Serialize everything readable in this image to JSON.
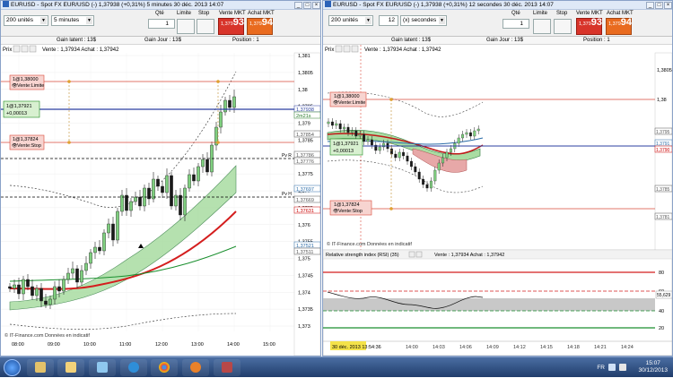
{
  "left_window": {
    "title": "EURUSD - Spot FX EUR/USD (-)   1,37938 (+0,31%)   5 minutes   30 déc. 2013 14:07",
    "units_select": "200 unités",
    "period_select": "5 minutes",
    "qty_label": "Qté",
    "qty_value": "1",
    "limit_label": "Limite",
    "stop_label": "Stop",
    "sell_label": "Vente MKT",
    "sell_price_prefix": "1,379",
    "sell_price_big": "93",
    "buy_label": "Achat MKT",
    "buy_price_prefix": "1,379",
    "buy_price_big": "94",
    "gain_latent": "Gain latent : 13$",
    "gain_jour": "Gain Jour : 13$",
    "position": "Position : 1",
    "header_prix": "Prix",
    "header_quote": "Vente : 1,37934  Achat : 1,37942",
    "order_limit_price": "1@1,38000",
    "order_limit_label": "Vente:Limite",
    "position_price": "1@1,37921",
    "position_gain": "+0,00013",
    "order_stop_price": "1@1,37824",
    "order_stop_label": "Vente:Stop",
    "pivot_r": "Pv R",
    "pivot_h": "Pv H",
    "watermark": "© IT-Finance.com  Données en indicatif",
    "y_ticks": [
      "1,381",
      "1,3805",
      "1,38",
      "1,3795",
      "1,379",
      "1,3785",
      "1,378",
      "1,3775",
      "1,377",
      "1,3765",
      "1,376",
      "1,3755",
      "1,375",
      "1,3745",
      "1,374",
      "1,3735",
      "1,373"
    ],
    "x_ticks": [
      "08:00",
      "09:00",
      "10:00",
      "11:00",
      "12:00",
      "13:00",
      "14:00",
      "15:00"
    ],
    "price_labels": [
      {
        "text": "1,37938",
        "color": "#2b3fa0"
      },
      {
        "text": "2m21s",
        "color": "#2b7d2b"
      },
      {
        "text": "1,37854",
        "color": "#555555"
      },
      {
        "text": "1,37786",
        "color": "#555555"
      },
      {
        "text": "1,37776",
        "color": "#555555"
      },
      {
        "text": "1,37697",
        "color": "#2b6ca8"
      },
      {
        "text": "1,37669",
        "color": "#555555"
      },
      {
        "text": "1,37631",
        "color": "#cc0000"
      },
      {
        "text": "1,37521",
        "color": "#2b6ca8"
      },
      {
        "text": "1,37511",
        "color": "#555555"
      }
    ]
  },
  "right_window": {
    "title": "EURUSD - Spot FX EUR/USD (-)   1,37938 (+0,31%)   12 secondes   30 déc. 2013 14:07",
    "units_select": "200 unités",
    "period_value": "12",
    "period_select": "(x) secondes",
    "qty_label": "Qté",
    "qty_value": "1",
    "limit_label": "Limite",
    "stop_label": "Stop",
    "sell_label": "Vente MKT",
    "sell_price_prefix": "1,379",
    "sell_price_big": "93",
    "buy_label": "Achat MKT",
    "buy_price_prefix": "1,379",
    "buy_price_big": "94",
    "gain_latent": "Gain latent : 13$",
    "gain_jour": "Gain Jour : 13$",
    "position": "Position : 1",
    "header_prix": "Prix",
    "header_quote": "Vente : 1,37934  Achat : 1,37942",
    "order_limit_price": "1@1,38000",
    "order_limit_label": "Vente:Limite",
    "position_price": "1@1,37921",
    "position_gain": "+0,00013",
    "order_stop_price": "1@1,37824",
    "order_stop_label": "Vente:Stop",
    "watermark": "© IT-Finance.com  Données en indicatif",
    "rsi_title": "Relative strength index (RSI) (35)",
    "rsi_quote": "Vente : 1,37934  Achat : 1,37942",
    "rsi_value": "55,629",
    "rsi_ticks": [
      "80",
      "60",
      "40",
      "20"
    ],
    "y_ticks": [
      "1,3805",
      "1,38",
      "1,3795",
      "1,379",
      "1,3785",
      "1,378"
    ],
    "x_ticks": [
      "30 déc. 2013 13:54:36",
      "14:00",
      "14:03",
      "14:06",
      "14:09",
      "14:12",
      "14:15",
      "14:18",
      "14:21",
      "14:24"
    ],
    "price_labels": [
      {
        "text": "1,3795",
        "color": "#555555"
      },
      {
        "text": "1,3791",
        "color": "#2b6ca8"
      },
      {
        "text": "1,3790",
        "color": "#cc0000"
      },
      {
        "text": "1,3785",
        "color": "#555555"
      },
      {
        "text": "1,3781",
        "color": "#555555"
      }
    ]
  },
  "taskbar": {
    "language": "FR",
    "time": "15:07",
    "date": "30/12/2013"
  },
  "colors": {
    "candle_up": "#7fd07f",
    "candle_down": "#1a1a1a",
    "sell_button": "#d8342a",
    "buy_button": "#e96b1f",
    "limit_line": "#d94a3a",
    "stop_line": "#d94a3a",
    "position_line": "#1f8a1f"
  },
  "icons": [
    "start-orb",
    "ie-icon",
    "explorer-icon",
    "media-icon",
    "chrome-icon",
    "media-player-icon",
    "network-icon",
    "volume-icon"
  ]
}
